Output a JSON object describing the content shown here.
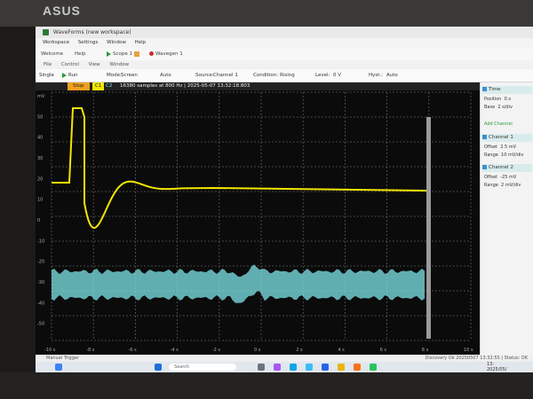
{
  "laptop": {
    "brand": "ASUS"
  },
  "window": {
    "title": "WaveForms (new workspace)"
  },
  "menu": {
    "items": [
      "Workspace",
      "Settings",
      "Window",
      "Help"
    ]
  },
  "toolbar1": {
    "items": [
      "Welcome",
      "Help",
      "Scope 1",
      "Wavegen 1"
    ]
  },
  "toolbar2": {
    "items": [
      "File",
      "Control",
      "View",
      "Window"
    ]
  },
  "toolbar3": {
    "items": [
      "Single",
      "Run",
      "Mode:",
      "Screen",
      "Auto",
      "Source:",
      "Channel 1",
      "Condition:",
      "Rising",
      "Level:",
      "0 V",
      "Hyst.:",
      "Auto"
    ]
  },
  "scope": {
    "stop_label": "Stop",
    "c1_label": "C1",
    "c2_label": "C2",
    "info": "16380 samples at 800 Hz | 2025-05-07 13:32:18.803",
    "y_ticks": [
      "mV",
      "50",
      "40",
      "30",
      "20",
      "10",
      "0",
      "-10",
      "-20",
      "-30",
      "-40",
      "-50"
    ],
    "x_ticks": [
      "-10 s",
      "-8 s",
      "-6 s",
      "-4 s",
      "-2 s",
      "0 s",
      "2 s",
      "4 s",
      "6 s",
      "8 s",
      "10 s"
    ]
  },
  "right_panel": {
    "time": {
      "label": "Time",
      "position_label": "Position",
      "position_value": "0 s",
      "base_label": "Base",
      "base_value": "2 s/div"
    },
    "add_channel": "Add Channel",
    "channel1": {
      "label": "Channel 1",
      "offset_label": "Offset",
      "offset_value": "2.5 mV",
      "range_label": "Range",
      "range_value": "10 mV/div"
    },
    "channel2": {
      "label": "Channel 2",
      "offset_label": "Offset",
      "offset_value": "-25 mV",
      "range_label": "Range",
      "range_value": "2 mV/div"
    }
  },
  "status": {
    "left": "Manual Trigger",
    "right": "Discovery Ok 20250507 13:32:55 | Status: OK"
  },
  "taskbar": {
    "search_placeholder": "Search",
    "time": "13:",
    "date": "2025/05/"
  },
  "colors": {
    "channel1": "#f2e600",
    "channel2": "#7fe6ea",
    "accent_green": "#2c9a3c",
    "plot_bg": "#0b0b0b"
  }
}
